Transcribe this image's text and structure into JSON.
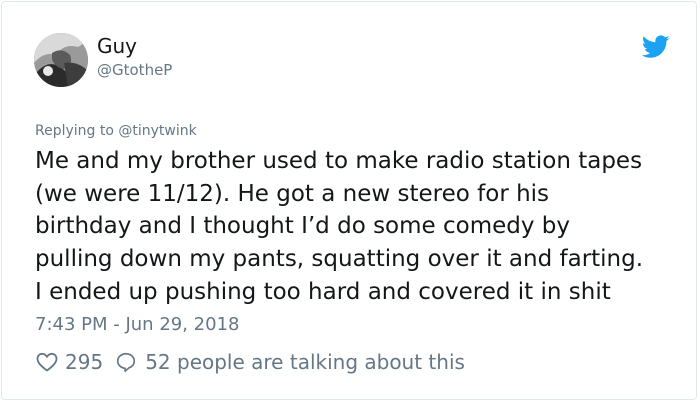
{
  "author": {
    "name": "Guy",
    "handle": "@GtotheP"
  },
  "icons": {
    "avatar": "avatar",
    "brand": "twitter-bird-icon",
    "like": "heart-icon",
    "reply": "speech-bubble-icon"
  },
  "colors": {
    "brand": "#1da1f2",
    "secondary_text": "#657786",
    "primary_text": "#14171a"
  },
  "replying_to": "Replying to @tinytwink",
  "tweet_lines": [
    "Me and my brother used to make radio station tapes",
    "(we were 11/12). He got a new stereo for his",
    "birthday and I thought I’d do some comedy by",
    "pulling down my pants, squatting over it and farting.",
    "I ended up pushing too hard and covered it in shit"
  ],
  "timestamp": "7:43 PM - Jun 29, 2018",
  "stats": {
    "likes": "295",
    "talking": "52 people are talking about this"
  }
}
